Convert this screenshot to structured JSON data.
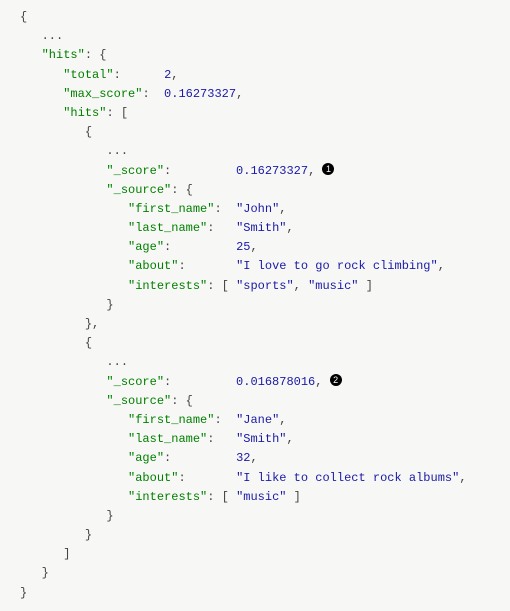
{
  "json": {
    "ellipsis": "...",
    "hits_key": "\"hits\"",
    "total_key": "\"total\"",
    "total_val": "2",
    "max_score_key": "\"max_score\"",
    "max_score_val": "0.16273327",
    "hits_arr_key": "\"hits\"",
    "score_key": "\"_score\"",
    "source_key": "\"_source\"",
    "first_name_key": "\"first_name\"",
    "last_name_key": "\"last_name\"",
    "age_key": "\"age\"",
    "about_key": "\"about\"",
    "interests_key": "\"interests\"",
    "hit1": {
      "score": "0.16273327",
      "first_name": "\"John\"",
      "last_name": "\"Smith\"",
      "age": "25",
      "about": "\"I love to go rock climbing\"",
      "interests1": "\"sports\"",
      "interests2": "\"music\""
    },
    "hit2": {
      "score": "0.016878016",
      "first_name": "\"Jane\"",
      "last_name": "\"Smith\"",
      "age": "32",
      "about": "\"I like to collect rock albums\"",
      "interests1": "\"music\""
    }
  },
  "callouts": {
    "c1": "1",
    "c2": "2"
  }
}
